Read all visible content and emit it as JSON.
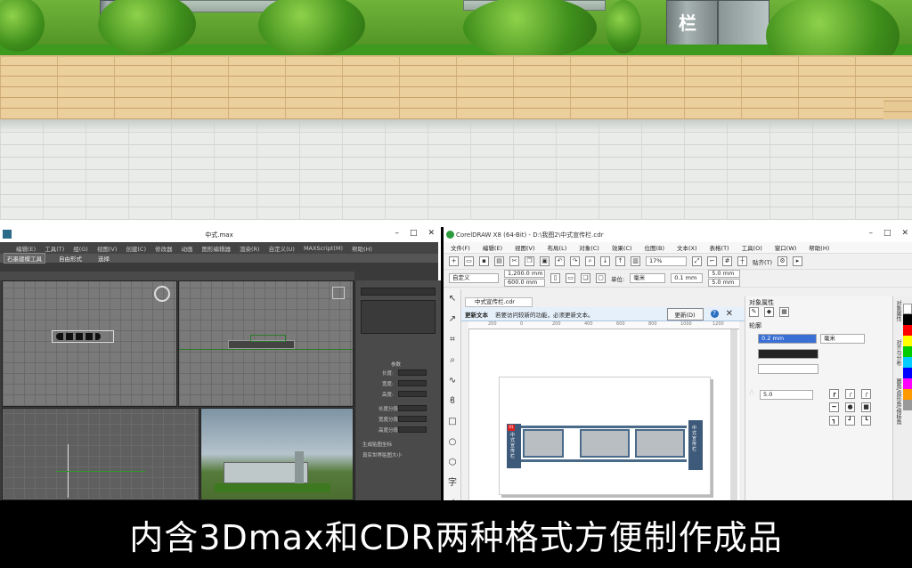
{
  "scene": {
    "sign_char": "栏"
  },
  "max_window": {
    "title": "中式.max",
    "menu": [
      "编辑(E)",
      "工具(T)",
      "组(G)",
      "视图(V)",
      "创建(C)",
      "修改器",
      "动画",
      "图形编辑器",
      "渲染(R)",
      "自定义(U)",
      "MAXScript(M)",
      "帮助(H)"
    ],
    "ribbon_tabs": [
      "石墨建模工具",
      "自由形式",
      "选择"
    ],
    "active_ribbon_tab": 0,
    "command_panel": {
      "rollout_title": "参数",
      "params": [
        "长度:",
        "宽度:",
        "高度:",
        "长度分段:",
        "宽度分段:",
        "高度分段:"
      ],
      "checkboxes": [
        "生成贴图坐标",
        "真实世界贴图大小"
      ]
    }
  },
  "cdr_window": {
    "title": "CorelDRAW X8 (64-Bit) - D:\\我图2\\中式宣传栏.cdr",
    "menu": [
      "文件(F)",
      "编辑(E)",
      "视图(V)",
      "布局(L)",
      "对象(C)",
      "效果(C)",
      "位图(B)",
      "文本(X)",
      "表格(T)",
      "工具(O)",
      "窗口(W)",
      "帮助(H)"
    ],
    "zoom": "17%",
    "snap": "贴齐(T)",
    "preset": "自定义",
    "width": "1,200.0 mm",
    "height": "600.0 mm",
    "units_label": "单位:",
    "units": "毫米",
    "nudge": "0.1 mm",
    "dup_x": "5.0 mm",
    "dup_y": "5.0 mm",
    "doc_tab": "中式宣传栏.cdr",
    "notice": {
      "title": "更新文本",
      "message": "若要访问较新的功能，必须更新文本。",
      "button": "更新(D)"
    },
    "ruler_ticks": [
      "200",
      "0",
      "200",
      "400",
      "600",
      "800",
      "1000",
      "1200"
    ],
    "object_props": {
      "title": "对象属性",
      "section": "轮廓",
      "outline_width": "0.2 mm",
      "outline_unit": "毫米",
      "miter": "5.0"
    },
    "docker_tabs": [
      "对象属性",
      "对齐与分布",
      "圆角/扇形角/倒棱角"
    ],
    "board_text_left": "中式宣传栏",
    "board_text_right": "中式宣传栏",
    "board_badge": "01"
  },
  "caption": "内含3Dmax和CDR两种格式方便制作成品"
}
